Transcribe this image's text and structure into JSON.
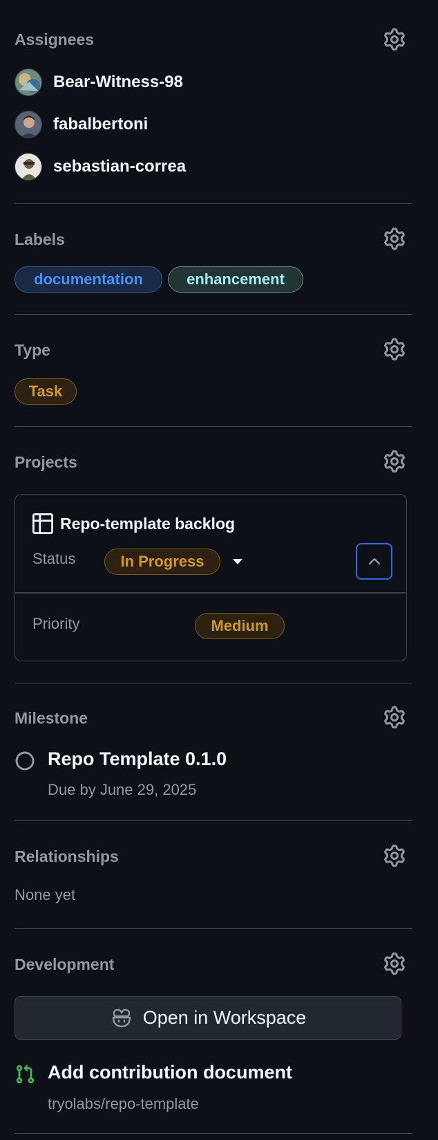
{
  "assignees": {
    "title": "Assignees",
    "users": [
      {
        "name": "Bear-Witness-98"
      },
      {
        "name": "fabalbertoni"
      },
      {
        "name": "sebastian-correa"
      }
    ]
  },
  "labels": {
    "title": "Labels",
    "items": [
      {
        "text": "documentation",
        "color": "#4493f8"
      },
      {
        "text": "enhancement",
        "color": "#a2eeef"
      }
    ]
  },
  "type": {
    "title": "Type",
    "value": "Task",
    "color": "#d29922"
  },
  "projects": {
    "title": "Projects",
    "project_name": "Repo-template backlog",
    "status_label": "Status",
    "status_value": "In Progress",
    "priority_label": "Priority",
    "priority_value": "Medium"
  },
  "milestone": {
    "title": "Milestone",
    "name": "Repo Template 0.1.0",
    "due": "Due by June 29, 2025"
  },
  "relationships": {
    "title": "Relationships",
    "value": "None yet"
  },
  "development": {
    "title": "Development",
    "workspace_button": "Open in Workspace",
    "pr_title": "Add contribution document",
    "pr_repo": "tryolabs/repo-template"
  },
  "colors": {
    "background": "#0d1117",
    "accent_blue": "#4493f8",
    "attention": "#d29922",
    "success": "#3fb950"
  }
}
